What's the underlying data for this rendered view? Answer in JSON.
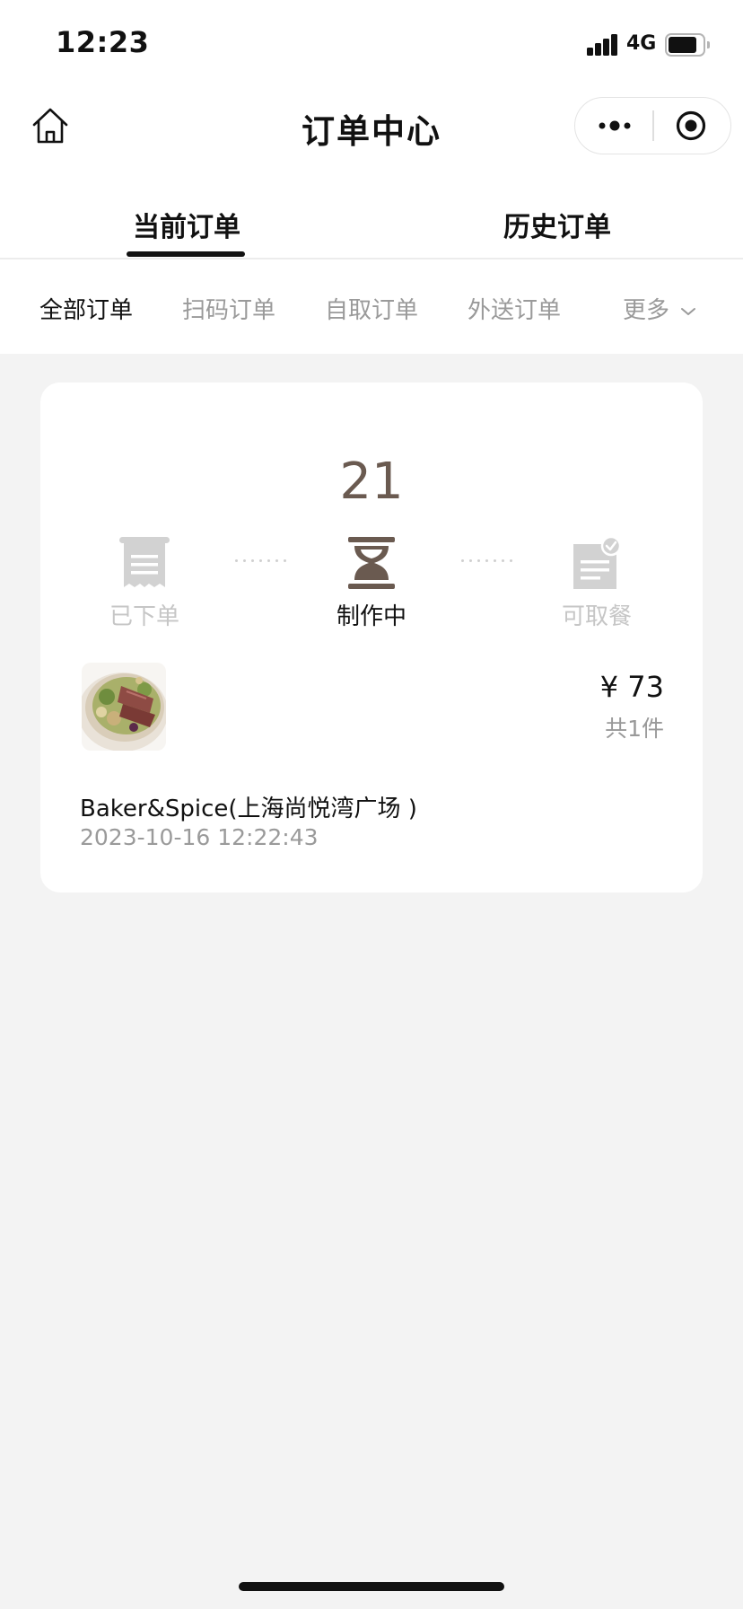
{
  "status_bar": {
    "time": "12:23",
    "network": "4G"
  },
  "nav": {
    "title": "订单中心"
  },
  "tabs": [
    {
      "label": "当前订单",
      "active": true
    },
    {
      "label": "历史订单",
      "active": false
    }
  ],
  "filters": [
    {
      "label": "全部订单",
      "active": true
    },
    {
      "label": "扫码订单",
      "active": false
    },
    {
      "label": "自取订单",
      "active": false
    },
    {
      "label": "外送订单",
      "active": false
    },
    {
      "label": "更多",
      "active": false
    }
  ],
  "order": {
    "pickup_number": "21",
    "steps": [
      {
        "label": "已下单",
        "icon": "receipt-icon",
        "active": false
      },
      {
        "label": "制作中",
        "icon": "hourglass-icon",
        "active": true
      },
      {
        "label": "可取餐",
        "icon": "ready-document-check-icon",
        "active": false
      }
    ],
    "price": "¥ 73",
    "quantity": "共1件",
    "store": "Baker&Spice(上海尚悦湾广场 )",
    "datetime": "2023-10-16 12:22:43"
  },
  "colors": {
    "accent_brown": "#6a5a50",
    "inactive_gray": "#c6c6c6",
    "background": "#f3f3f3",
    "card": "#ffffff"
  }
}
